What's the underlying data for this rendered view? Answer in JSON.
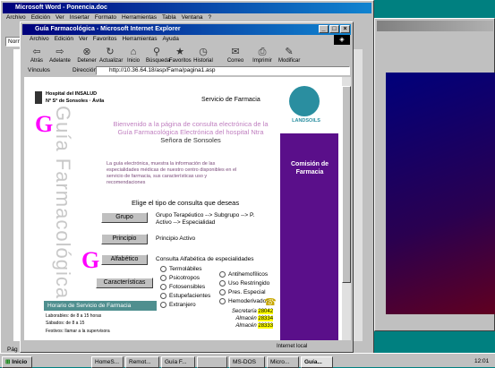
{
  "word": {
    "title": "Microsoft Word - Ponencia.doc",
    "menu": [
      "Archivo",
      "Edición",
      "Ver",
      "Insertar",
      "Formato",
      "Herramientas",
      "Tabla",
      "Ventana",
      "?"
    ],
    "style_box": "Norm",
    "status": "Pág"
  },
  "ie": {
    "title": "Guía Farmacológica - Microsoft Internet Explorer",
    "menu": [
      "Archivo",
      "Edición",
      "Ver",
      "Favoritos",
      "Herramientas",
      "Ayuda"
    ],
    "toolbar": [
      "Atrás",
      "Adelante",
      "Detener",
      "Actualizar",
      "Inicio",
      "Búsqueda",
      "Favoritos",
      "Historial",
      "Correo",
      "Imprimir",
      "Modificar"
    ],
    "links_label": "Vínculos",
    "address_label": "Dirección",
    "address": "http://10.36.64.18/asp/Fama/pagina1.asp",
    "status_zone": "Internet local"
  },
  "page": {
    "hospital_line1": "Hospital del INSALUD",
    "hospital_line2": "Nª Sª de Sonsoles · Ávila",
    "service": "Servicio de Farmacia",
    "logo_text": "LANDSOILS",
    "welcome_pre": "Bienvenido a la página de consulta electrónica de la",
    "welcome_mid": "Guía Farmacológica Electrónica del hospital Ntra",
    "welcome_end": "Señora de Sonsoles",
    "description": "La guía electrónica, muestra la información de las especialidades médicas de nuestro centro disponibles en el servicio de farmacia, sus características uso y recomendaciones",
    "choose": "Elige el tipo de consulta que deseas",
    "vertical_brand": "Guía Farmacológica",
    "commission": "Comisión de Farmacia",
    "buttons": [
      {
        "label": "Grupo",
        "desc": "Grupo Terapéutico --> Subgrupo --> P. Activo --> Especialidad"
      },
      {
        "label": "Principio",
        "desc": "Principio Activo"
      },
      {
        "label": "Alfabético",
        "desc": "Consulta Alfabética de especialidades"
      },
      {
        "label": "Características",
        "desc": ""
      }
    ],
    "radios_left": [
      "Termolábiles",
      "Psicotropos",
      "Fotosensibles",
      "Estupefacientes",
      "Extranjero"
    ],
    "radios_right": [
      "Antihemofílicos",
      "Uso Restringido",
      "Pres. Especial",
      "Hemoderivados"
    ],
    "hours_title": "Horario de Servicio de Farmacia",
    "hours_1": "Laborables: de 8 a 15 horas",
    "hours_2": "Sábados: de 8 a 15",
    "hours_3": "Festivos: llamar a la supervisora",
    "phones": [
      {
        "label": "Secretaría",
        "num": "28042"
      },
      {
        "label": "Almacén",
        "num": "28334"
      },
      {
        "label": "Almacén",
        "num": "28333"
      }
    ]
  },
  "taskbar": {
    "start": "Inicio",
    "items": [
      "HomeS...",
      "Remot...",
      "Guía F...",
      "",
      "MS-DOS",
      "Micro...",
      "Guía..."
    ],
    "clock": "12:01"
  },
  "colors": {
    "purple": "#5a0f8a",
    "magenta": "#ff00ff",
    "teal": "#008080",
    "navy": "#00007b"
  }
}
